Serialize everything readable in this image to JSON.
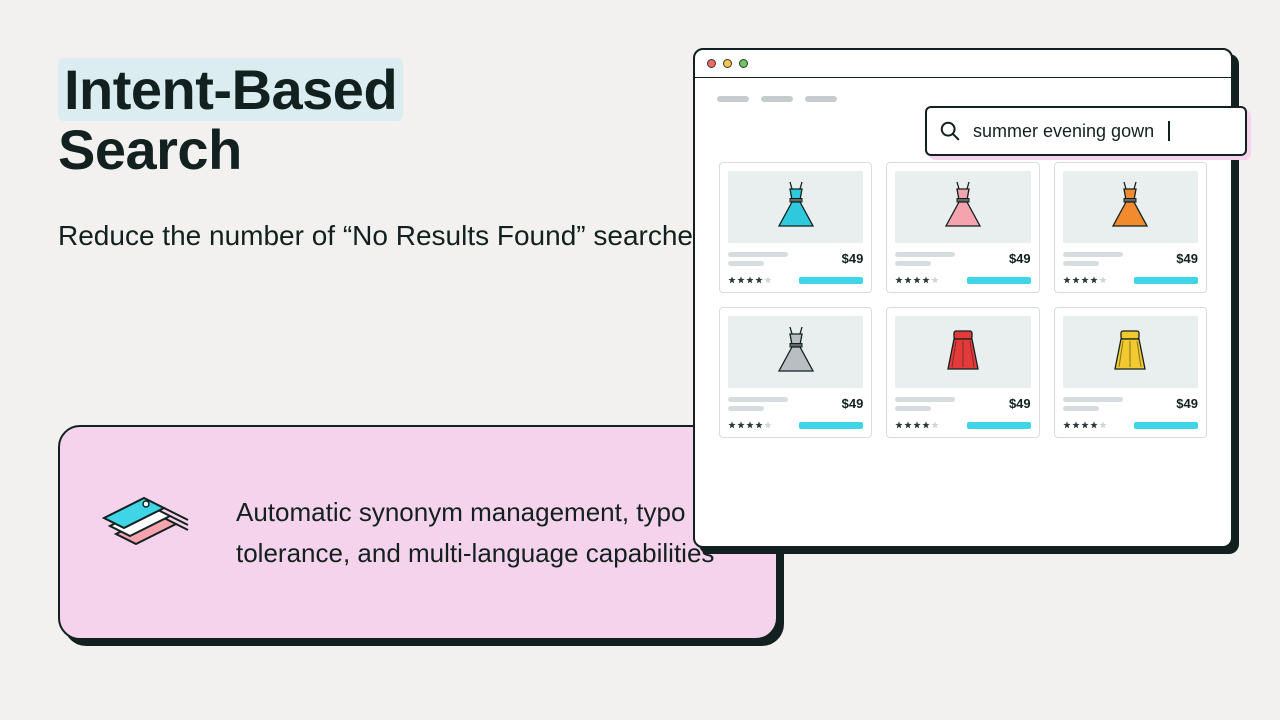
{
  "headline": {
    "highlight": "Intent-Based",
    "rest": "Search"
  },
  "subhead": "Reduce the number of “No Results Found” searches",
  "callout": {
    "text": "Automatic synonym management, typo tolerance, and multi-language capabilities"
  },
  "search": {
    "query": "summer evening gown"
  },
  "products": [
    {
      "price": "$49",
      "rating": 4,
      "garment": "dress",
      "color": "#2ec9dd"
    },
    {
      "price": "$49",
      "rating": 4,
      "garment": "dress",
      "color": "#f5a3ad"
    },
    {
      "price": "$49",
      "rating": 4,
      "garment": "dress",
      "color": "#f28a2e"
    },
    {
      "price": "$49",
      "rating": 4,
      "garment": "dress",
      "color": "#b8bec2"
    },
    {
      "price": "$49",
      "rating": 4,
      "garment": "skirt",
      "color": "#e53a3a"
    },
    {
      "price": "$49",
      "rating": 4,
      "garment": "skirt",
      "color": "#f2c92e"
    }
  ]
}
